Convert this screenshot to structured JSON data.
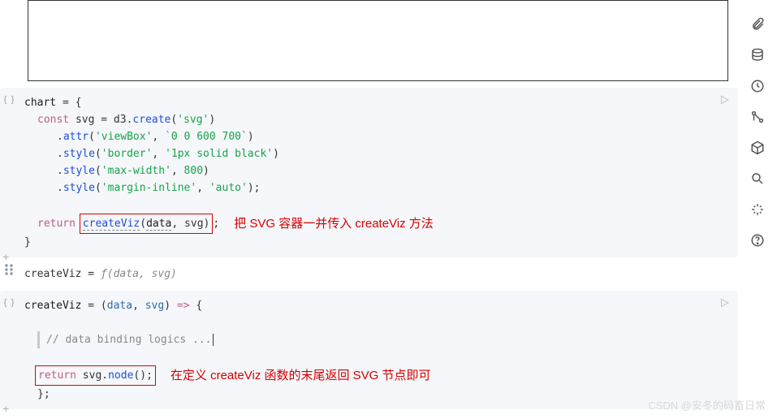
{
  "cells": {
    "chart": {
      "l1_a": "chart",
      "l1_b": " = {",
      "l2_a": "const",
      "l2_b": " svg = d3.",
      "l2_c": "create",
      "l2_d": "(",
      "l2_e": "'svg'",
      "l2_f": ")",
      "l3_a": ".",
      "l3_b": "attr",
      "l3_c": "(",
      "l3_d": "'viewBox'",
      "l3_e": ", ",
      "l3_f": "`0 0 600 700`",
      "l3_g": ")",
      "l4_a": ".",
      "l4_b": "style",
      "l4_c": "(",
      "l4_d": "'border'",
      "l4_e": ", ",
      "l4_f": "'1px solid black'",
      "l4_g": ")",
      "l5_a": ".",
      "l5_b": "style",
      "l5_c": "(",
      "l5_d": "'max-width'",
      "l5_e": ", ",
      "l5_f": "800",
      "l5_g": ")",
      "l6_a": ".",
      "l6_b": "style",
      "l6_c": "(",
      "l6_d": "'margin-inline'",
      "l6_e": ", ",
      "l6_f": "'auto'",
      "l6_g": ");",
      "l7_a": "return",
      "l7_b": " ",
      "l7_hbA": "createViz",
      "l7_hbB": "(",
      "l7_hbC": "data",
      "l7_hbD": ", svg)",
      "l7_c": ";",
      "l8": "}",
      "anno1": "把 SVG 容器一并传入 createViz 方法"
    },
    "viz_summary": {
      "a": "createViz",
      "b": " = ",
      "c": "ƒ",
      "d": "(data, svg)"
    },
    "viz_def": {
      "l1_a": "createViz",
      "l1_b": " = (",
      "l1_c": "data",
      "l1_d": ", ",
      "l1_e": "svg",
      "l1_f": ") ",
      "l1_g": "=>",
      "l1_h": " {",
      "l2": "// data binding logics ...",
      "l3_a": "return",
      "l3_b": " svg.",
      "l3_c": "node",
      "l3_d": "();",
      "l4": "};",
      "anno2": "在定义 createViz 函数的末尾返回 SVG 节点即可"
    }
  },
  "watermark": "CSDN @安冬的码畜日常"
}
